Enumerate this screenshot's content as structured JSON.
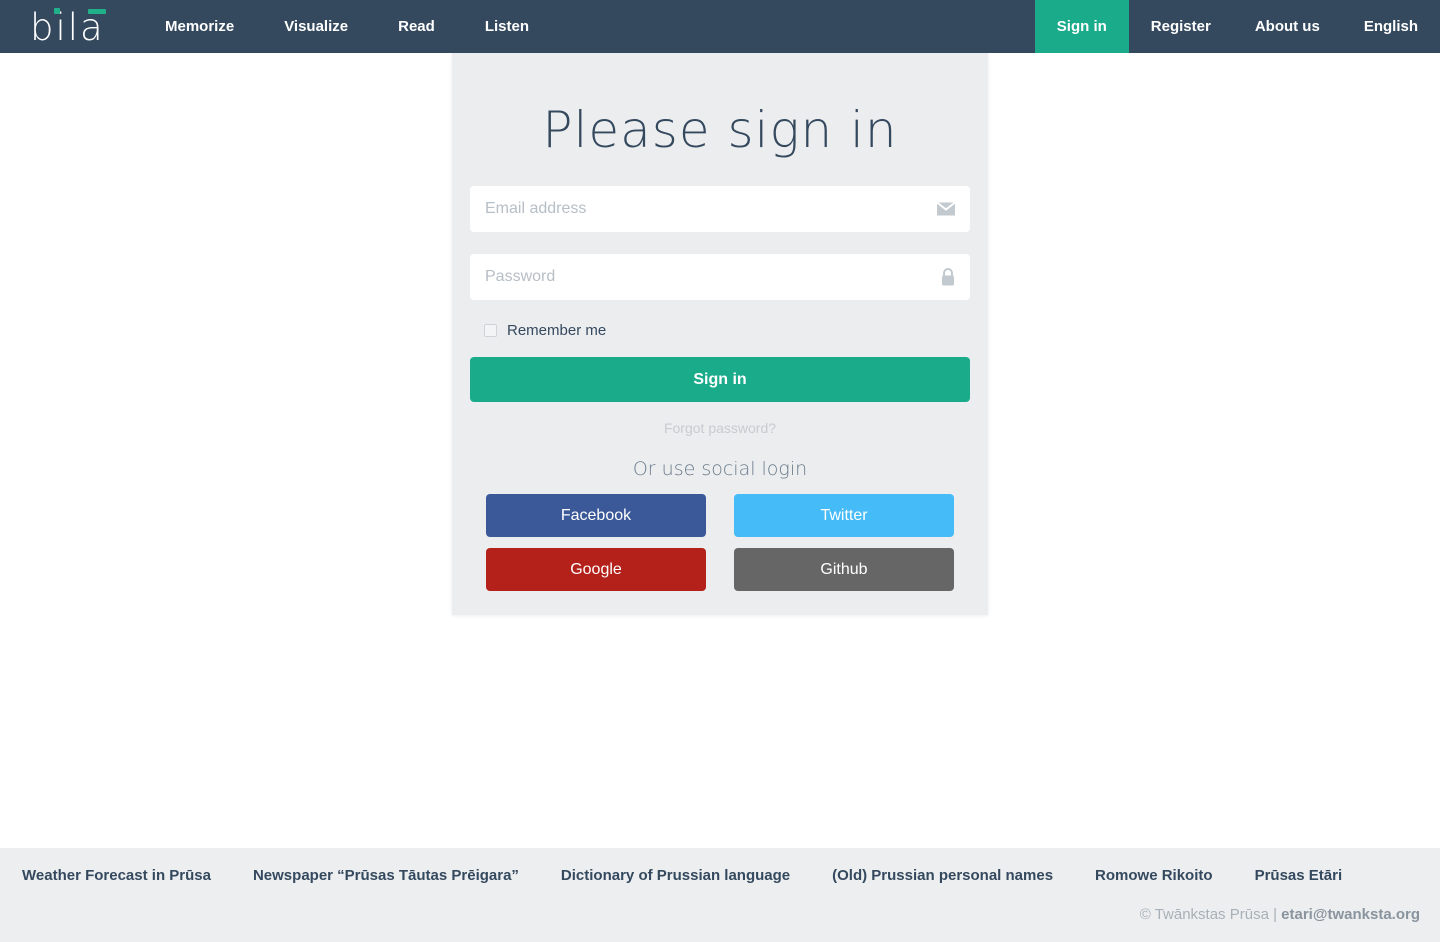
{
  "navbar": {
    "brand": {
      "text": "bila",
      "accent_color": "#20b08a"
    },
    "background_color": "#35495e",
    "left_items": [
      {
        "label": "Memorize"
      },
      {
        "label": "Visualize"
      },
      {
        "label": "Read"
      },
      {
        "label": "Listen"
      }
    ],
    "right_items": [
      {
        "label": "Sign in",
        "active": true
      },
      {
        "label": "Register",
        "active": false
      },
      {
        "label": "About us",
        "active": false
      },
      {
        "label": "English",
        "active": false
      }
    ],
    "active_color": "#1aab8a"
  },
  "login_card": {
    "title": "Please sign in",
    "email": {
      "placeholder": "Email address",
      "value": "",
      "icon": "envelope-icon"
    },
    "password": {
      "placeholder": "Password",
      "value": "",
      "icon": "lock-icon"
    },
    "remember": {
      "label": "Remember me",
      "checked": false
    },
    "submit_label": "Sign in",
    "submit_color": "#1aab8a",
    "forgot_label": "Forgot password?",
    "social_title": "Or use social login",
    "social_buttons": [
      {
        "label": "Facebook",
        "color": "#3b5998"
      },
      {
        "label": "Twitter",
        "color": "#45bbf7"
      },
      {
        "label": "Google",
        "color": "#b4211a"
      },
      {
        "label": "Github",
        "color": "#666666"
      }
    ]
  },
  "footer": {
    "links": [
      {
        "label": "Weather Forecast in Prūsa"
      },
      {
        "label": "Newspaper “Prūsas Tāutas Prēigara”"
      },
      {
        "label": "Dictionary of Prussian language"
      },
      {
        "label": "(Old) Prussian personal names"
      },
      {
        "label": "Romowe Rikoito"
      },
      {
        "label": "Prūsas Etāri"
      }
    ],
    "copyright_prefix": "© Twānkstas Prūsa | ",
    "copyright_email": "etari@twanksta.org"
  }
}
